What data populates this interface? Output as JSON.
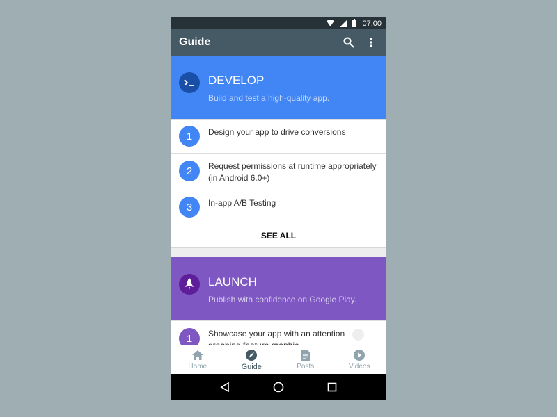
{
  "status_bar": {
    "time": "07:00",
    "icons": [
      "wifi-icon",
      "signal-icon",
      "battery-icon"
    ]
  },
  "app_bar": {
    "title": "Guide",
    "icons": [
      "search-icon",
      "more-vert-icon"
    ]
  },
  "sections": [
    {
      "title": "DEVELOP",
      "subtitle": "Build and test a high-quality app.",
      "color": "#4285f4",
      "icon_color": "#1a4fa8",
      "icon": "terminal-icon",
      "items": [
        {
          "number": "1",
          "text": "Design your app to drive conversions"
        },
        {
          "number": "2",
          "text": "Request permissions at runtime appropriately (in Android 6.0+)"
        },
        {
          "number": "3",
          "text": "In-app A/B Testing"
        }
      ],
      "see_all": "SEE ALL"
    },
    {
      "title": "LAUNCH",
      "subtitle": "Publish with confidence on Google Play.",
      "color": "#7e57c2",
      "icon_color": "#5e1e9a",
      "icon": "rocket-icon",
      "items": [
        {
          "number": "1",
          "text": "Showcase your app with an attention grabbing feature graphic"
        }
      ]
    }
  ],
  "bottom_nav": [
    {
      "label": "Home",
      "icon": "home-icon"
    },
    {
      "label": "Guide",
      "icon": "compass-icon",
      "active": true
    },
    {
      "label": "Posts",
      "icon": "document-icon"
    },
    {
      "label": "Videos",
      "icon": "play-circle-icon"
    }
  ],
  "system_nav": [
    "back-icon",
    "home-circle-icon",
    "recents-icon"
  ]
}
